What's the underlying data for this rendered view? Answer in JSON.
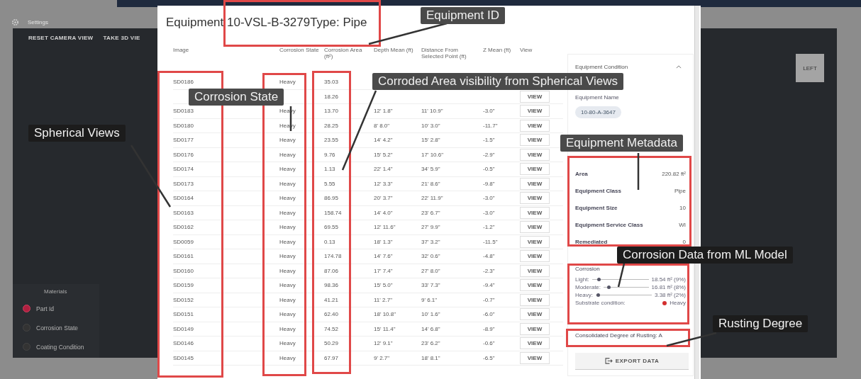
{
  "app": {
    "settings_label": "Settings",
    "toolbar_buttons": [
      "RESET CAMERA VIEW",
      "TAKE 3D VIE"
    ],
    "view_cube_label": "LEFT",
    "legend": {
      "title": "Materials",
      "items": [
        {
          "label": "Part Id",
          "selected": true
        },
        {
          "label": "Corrosion State",
          "selected": false
        },
        {
          "label": "Coating Condition",
          "selected": false
        }
      ]
    }
  },
  "dialog": {
    "title": "Equipment",
    "equipment_id": "10-VSL-B-3279",
    "type_label": "Type:",
    "type_value": "Pipe",
    "table": {
      "columns": [
        "Image",
        "Corrosion State",
        "Corrosion Area (ft²)",
        "Depth Mean (ft)",
        "Distance From Selected Point (ft)",
        "Z Mean (ft)",
        "View"
      ],
      "rows": [
        {
          "image": "SD0186",
          "state": "Heavy",
          "area": "35.03",
          "depth": null,
          "distance": null,
          "z": null,
          "view": null
        },
        {
          "image": null,
          "state": null,
          "area": "18.26",
          "depth": null,
          "distance": null,
          "z": null,
          "view": "VIEW"
        },
        {
          "image": "SD0183",
          "state": "Heavy",
          "area": "13.70",
          "depth": "12' 1.8\"",
          "distance": "11' 10.9\"",
          "z": "-3.0\"",
          "view": "VIEW"
        },
        {
          "image": "SD0180",
          "state": "Heavy",
          "area": "28.25",
          "depth": "8' 8.0\"",
          "distance": "10' 3.0\"",
          "z": "-11.7\"",
          "view": "VIEW"
        },
        {
          "image": "SD0177",
          "state": "Heavy",
          "area": "23.55",
          "depth": "14' 4.2\"",
          "distance": "15' 2.8\"",
          "z": "-1.5\"",
          "view": "VIEW"
        },
        {
          "image": "SD0176",
          "state": "Heavy",
          "area": "9.76",
          "depth": "15' 5.2\"",
          "distance": "17' 10.6\"",
          "z": "-2.9\"",
          "view": "VIEW"
        },
        {
          "image": "SD0174",
          "state": "Heavy",
          "area": "1.13",
          "depth": "22' 1.4\"",
          "distance": "34' 5.9\"",
          "z": "-0.5\"",
          "view": "VIEW"
        },
        {
          "image": "SD0173",
          "state": "Heavy",
          "area": "5.55",
          "depth": "12' 3.3\"",
          "distance": "21' 8.6\"",
          "z": "-9.8\"",
          "view": "VIEW"
        },
        {
          "image": "SD0164",
          "state": "Heavy",
          "area": "86.95",
          "depth": "20' 3.7\"",
          "distance": "22' 11.9\"",
          "z": "-3.0\"",
          "view": "VIEW"
        },
        {
          "image": "SD0163",
          "state": "Heavy",
          "area": "158.74",
          "depth": "14' 4.0\"",
          "distance": "23' 6.7\"",
          "z": "-3.0\"",
          "view": "VIEW"
        },
        {
          "image": "SD0162",
          "state": "Heavy",
          "area": "69.55",
          "depth": "12' 11.6\"",
          "distance": "27' 9.9\"",
          "z": "-1.2\"",
          "view": "VIEW"
        },
        {
          "image": "SD0059",
          "state": "Heavy",
          "area": "0.13",
          "depth": "18' 1.3\"",
          "distance": "37' 3.2\"",
          "z": "-11.5\"",
          "view": "VIEW"
        },
        {
          "image": "SD0161",
          "state": "Heavy",
          "area": "174.78",
          "depth": "14' 7.6\"",
          "distance": "32' 0.6\"",
          "z": "-4.8\"",
          "view": "VIEW"
        },
        {
          "image": "SD0160",
          "state": "Heavy",
          "area": "87.06",
          "depth": "17' 7.4\"",
          "distance": "27' 8.0\"",
          "z": "-2.3\"",
          "view": "VIEW"
        },
        {
          "image": "SD0159",
          "state": "Heavy",
          "area": "98.36",
          "depth": "15' 5.0\"",
          "distance": "33' 7.3\"",
          "z": "-9.4\"",
          "view": "VIEW"
        },
        {
          "image": "SD0152",
          "state": "Heavy",
          "area": "41.21",
          "depth": "11' 2.7\"",
          "distance": "9' 6.1\"",
          "z": "-0.7\"",
          "view": "VIEW"
        },
        {
          "image": "SD0151",
          "state": "Heavy",
          "area": "62.40",
          "depth": "18' 10.8\"",
          "distance": "10' 1.6\"",
          "z": "-6.0\"",
          "view": "VIEW"
        },
        {
          "image": "SD0149",
          "state": "Heavy",
          "area": "74.52",
          "depth": "15' 11.4\"",
          "distance": "14' 6.8\"",
          "z": "-8.9\"",
          "view": "VIEW"
        },
        {
          "image": "SD0146",
          "state": "Heavy",
          "area": "50.29",
          "depth": "12' 9.1\"",
          "distance": "23' 6.2\"",
          "z": "-0.6\"",
          "view": "VIEW"
        },
        {
          "image": "SD0145",
          "state": "Heavy",
          "area": "67.97",
          "depth": "9' 2.7\"",
          "distance": "18' 8.1\"",
          "z": "-6.5\"",
          "view": "VIEW"
        }
      ]
    },
    "panel": {
      "section_title": "Equipment Condition",
      "expanded": true,
      "name_label": "Equipment Name",
      "name_value": "10-80-A-3647",
      "metadata": [
        {
          "label": "Area",
          "value": "220.82 ft²"
        },
        {
          "label": "Equipment Class",
          "value": "Pipe"
        },
        {
          "label": "Equipment Size",
          "value": "10"
        },
        {
          "label": "Equipment Service Class",
          "value": "WI"
        },
        {
          "label": "Remediated",
          "value": "0"
        }
      ],
      "corrosion": {
        "title": "Corrosion",
        "levels": [
          {
            "label": "Light:",
            "level": 0.09,
            "reading": "18.54 ft² (9%)"
          },
          {
            "label": "Moderate:",
            "level": 0.08,
            "reading": "16.81 ft² (8%)"
          },
          {
            "label": "Heavy:",
            "level": 0.02,
            "reading": "3.38 ft² (2%)"
          }
        ],
        "substrate": {
          "label": "Substrate condition:",
          "value": "Heavy",
          "color": "#d32f2f"
        }
      },
      "rusting": "Consolidated Degree of Rusting: A",
      "export_button": "EXPORT DATA"
    }
  },
  "annotations": [
    {
      "text": "Equipment ID"
    },
    {
      "text": "Corrosion State"
    },
    {
      "text": "Corroded Area visibility from Spherical Views"
    },
    {
      "text": "Spherical Views"
    },
    {
      "text": "Equipment Metadata"
    },
    {
      "text": "Corrosion Data from ML Model"
    },
    {
      "text": "Rusting Degree"
    }
  ]
}
